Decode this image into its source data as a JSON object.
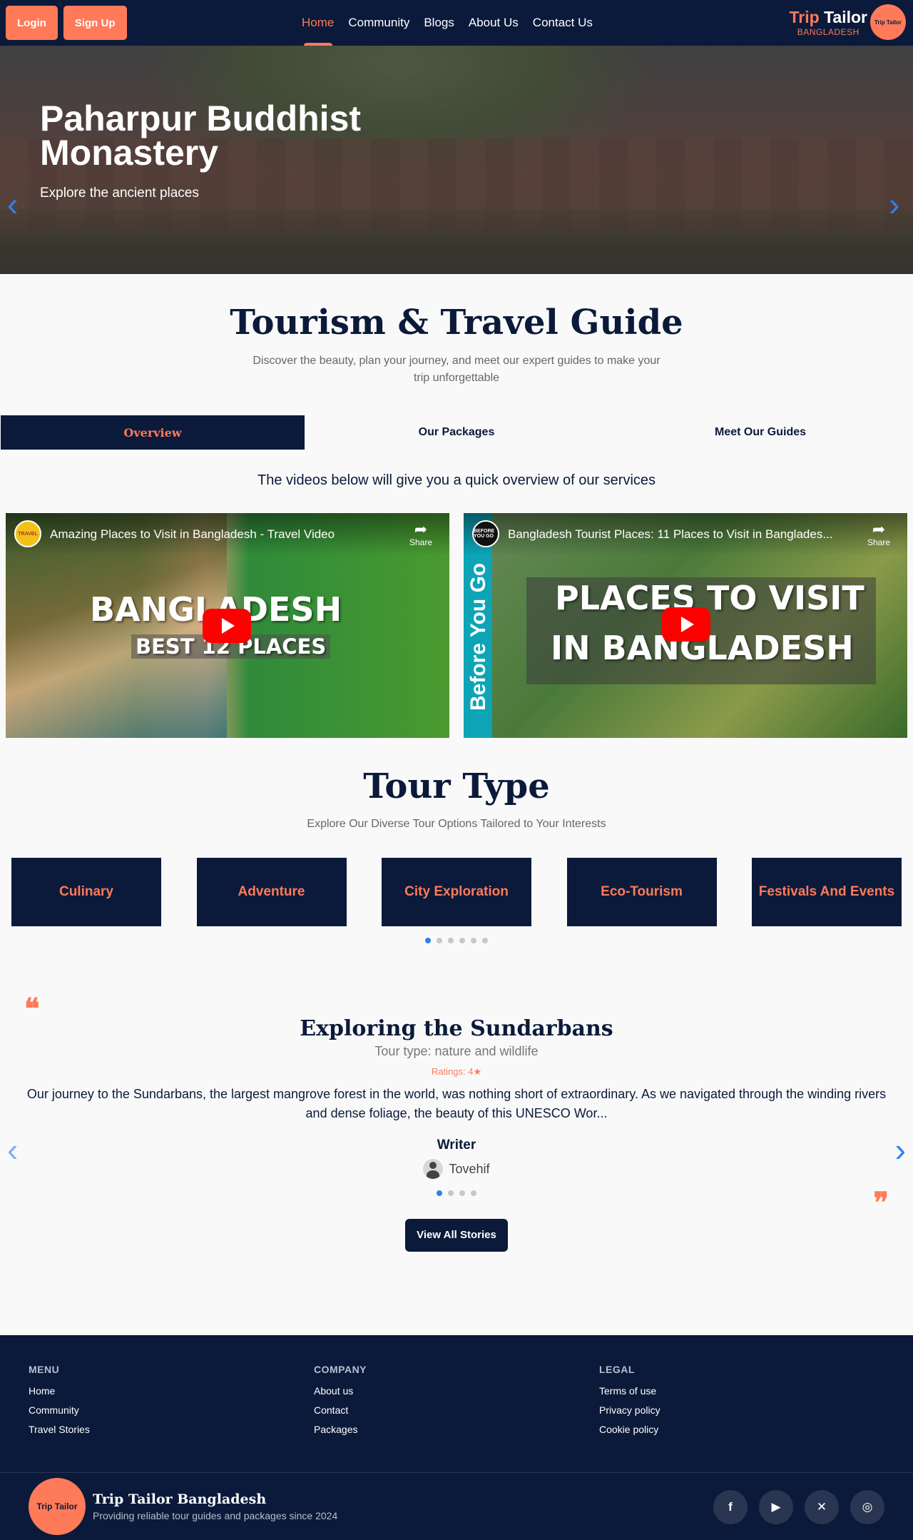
{
  "navbar": {
    "login_label": "Login",
    "signup_label": "Sign Up",
    "links": [
      "Home",
      "Community",
      "Blogs",
      "About Us",
      "Contact Us"
    ],
    "active_link": "Home",
    "brand_first": "Trip",
    "brand_second": "Tailor",
    "brand_sub": "BANGLADESH",
    "brand_logo_text": "Trip Tailor"
  },
  "hero": {
    "title": "Paharpur Buddhist Monastery",
    "subtitle": "Explore the ancient places",
    "timer": "5s",
    "prev_icon": "‹",
    "next_icon": "›",
    "slides": 4,
    "active_slide": 0
  },
  "intro": {
    "title": "Tourism & Travel Guide",
    "description": "Discover the beauty, plan your journey, and meet our expert guides to make your trip unforgettable"
  },
  "tabs": {
    "items": [
      "Overview",
      "Our Packages",
      "Meet Our Guides"
    ],
    "active": "Overview"
  },
  "overview_note": "The videos below will give you a quick overview of our services",
  "videos": [
    {
      "title": "Amazing Places to Visit in Bangladesh - Travel Video",
      "share": "Share",
      "big_text_1": "BANGLADESH",
      "big_text_2": "BEST 12 PLACES",
      "channel": "TRAVEL"
    },
    {
      "title": "Bangladesh Tourist Places: 11 Places to Visit in Banglades...",
      "share": "Share",
      "big_text_1": "PLACES TO VISIT",
      "big_text_2": "IN BANGLADESH",
      "strip_text": "Before You Go",
      "channel": "BEFORE YOU GO"
    }
  ],
  "tour_type": {
    "title": "Tour Type",
    "description": "Explore Our Diverse Tour Options Tailored to Your Interests",
    "cards": [
      "Culinary",
      "Adventure",
      "City Exploration",
      "Eco-Tourism",
      "Festivals And Events"
    ],
    "dots": 6,
    "active_dot": 0
  },
  "story": {
    "title": "Exploring the Sundarbans",
    "tour_type": "Tour type: nature and wildlife",
    "rating": "Ratings: 4★",
    "body": "Our journey to the Sundarbans, the largest mangrove forest in the world, was nothing short of extraordinary. As we navigated through the winding rivers and dense foliage, the beauty of this UNESCO Wor...",
    "writer_label": "Writer",
    "writer_name": "Tovehif",
    "quote_open": "❝",
    "quote_close": "❞",
    "dots": 4,
    "active_dot": 0,
    "view_all": "View All Stories"
  },
  "footer": {
    "menu_title": "MENU",
    "menu": [
      "Home",
      "Community",
      "Travel Stories"
    ],
    "company_title": "COMPANY",
    "company": [
      "About us",
      "Contact",
      "Packages"
    ],
    "legal_title": "LEGAL",
    "legal": [
      "Terms of use",
      "Privacy policy",
      "Cookie policy"
    ],
    "brand_name": "Trip Tailor Bangladesh",
    "brand_tagline": "Providing reliable tour guides and packages since 2024",
    "logo_text": "Trip Tailor",
    "socials": [
      "facebook-icon",
      "youtube-icon",
      "x-icon",
      "instagram-icon"
    ]
  },
  "colors": {
    "navy": "#0b1a3a",
    "accent": "#ff7a59",
    "link_blue": "#2f80ed"
  }
}
